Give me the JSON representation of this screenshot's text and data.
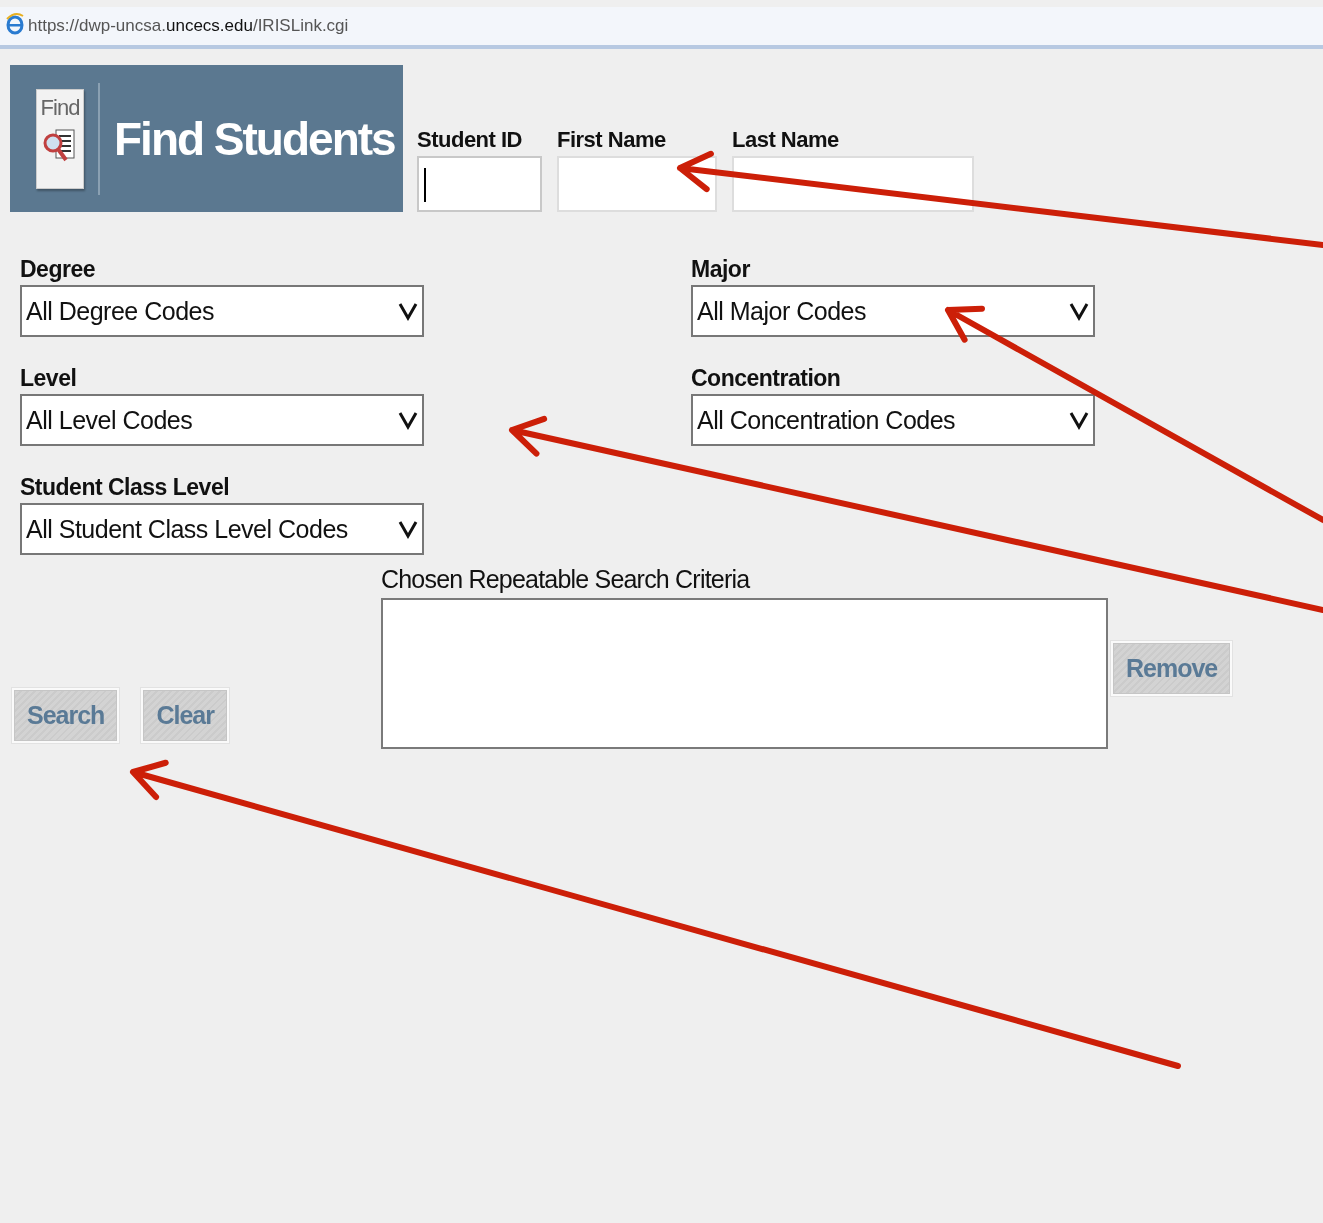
{
  "address_bar": {
    "url": "https://dwp-uncsa.**uncecs.edu**/IRISLink.cgi"
  },
  "header": {
    "logo_text": "Find",
    "title": "Find Students"
  },
  "name_fields": [
    {
      "label": "Student ID",
      "focused": true
    },
    {
      "label": "First Name",
      "focused": false
    },
    {
      "label": "Last Name",
      "focused": false
    }
  ],
  "left_selects": [
    {
      "label": "Degree",
      "value": "All Degree Codes"
    },
    {
      "label": "Level",
      "value": "All Level Codes"
    },
    {
      "label": "Student Class Level",
      "value": "All Student Class Level Codes"
    }
  ],
  "right_selects": [
    {
      "label": "Major",
      "value": "All Major Codes"
    },
    {
      "label": "Concentration",
      "value": "All Concentration Codes"
    }
  ],
  "criteria": {
    "label": "Chosen Repeatable Search Criteria",
    "remove_button": "Remove"
  },
  "buttons": [
    "Search",
    "Clear"
  ]
}
